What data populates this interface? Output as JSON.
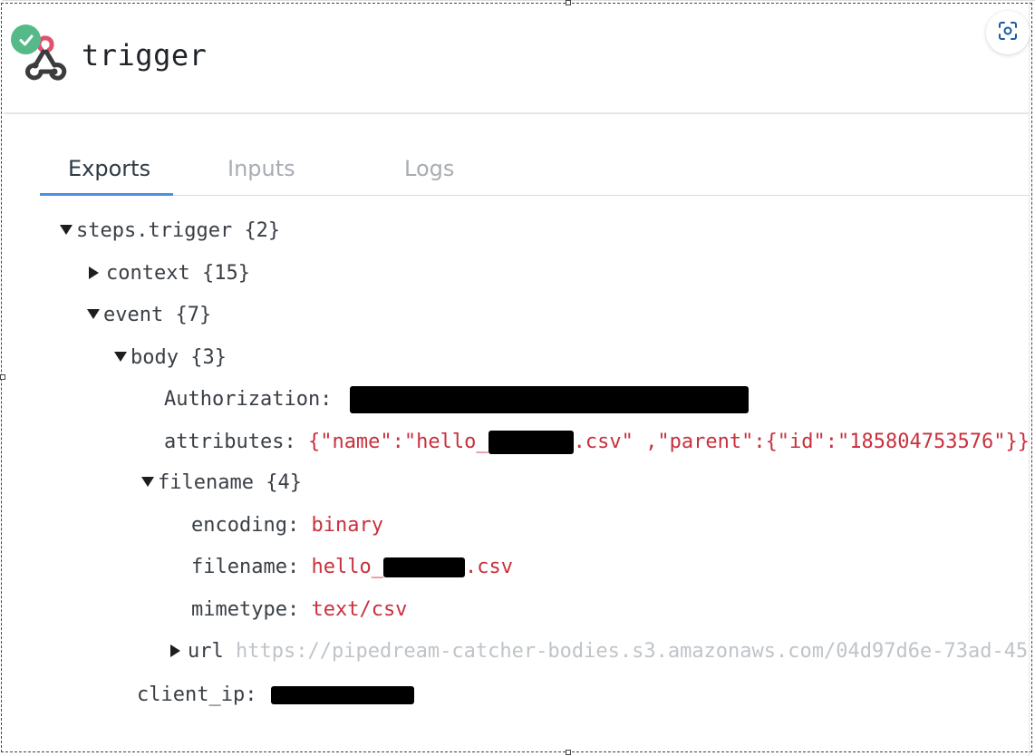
{
  "header": {
    "title": "trigger",
    "status": "success",
    "status_color": "#55b989",
    "icon": "webhook-icon",
    "scan_button_icon": "scan-icon"
  },
  "tabs": [
    {
      "label": "Exports",
      "active": true
    },
    {
      "label": "Inputs",
      "active": false
    },
    {
      "label": "Logs",
      "active": false
    }
  ],
  "tree": {
    "root": {
      "key": "steps.trigger",
      "count": "{2}"
    },
    "context": {
      "key": "context",
      "count": "{15}"
    },
    "event": {
      "key": "event",
      "count": "{7}"
    },
    "body": {
      "key": "body",
      "count": "{3}"
    },
    "authorization": {
      "key": "Authorization:"
    },
    "attributes": {
      "key": "attributes:",
      "value_prefix": "{\"name\":\"hello_",
      "value_suffix": ".csv\" ,\"parent\":{\"id\":\"185804753576\"}}"
    },
    "filename_obj": {
      "key": "filename",
      "count": "{4}"
    },
    "encoding": {
      "key": "encoding:",
      "value": "binary"
    },
    "filename": {
      "key": "filename:",
      "value_prefix": "hello_",
      "value_suffix": ".csv"
    },
    "mimetype": {
      "key": "mimetype:",
      "value": "text/csv"
    },
    "url": {
      "key": "url",
      "value": "https://pipedream-catcher-bodies.s3.amazonaws.com/04d97d6e-73ad-45"
    },
    "client_ip": {
      "key": "client_ip:"
    }
  },
  "colors": {
    "accent": "#4a90e2",
    "value_red": "#c9303d",
    "muted": "#a8adb3"
  }
}
